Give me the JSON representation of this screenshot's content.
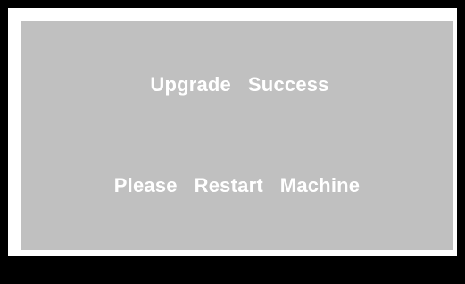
{
  "dialog": {
    "title": "Upgrade   Success",
    "message": "Please   Restart   Machine"
  },
  "colors": {
    "background": "#000000",
    "frame": "#ffffff",
    "panel": "#c0c0c0",
    "text": "#ffffff"
  }
}
